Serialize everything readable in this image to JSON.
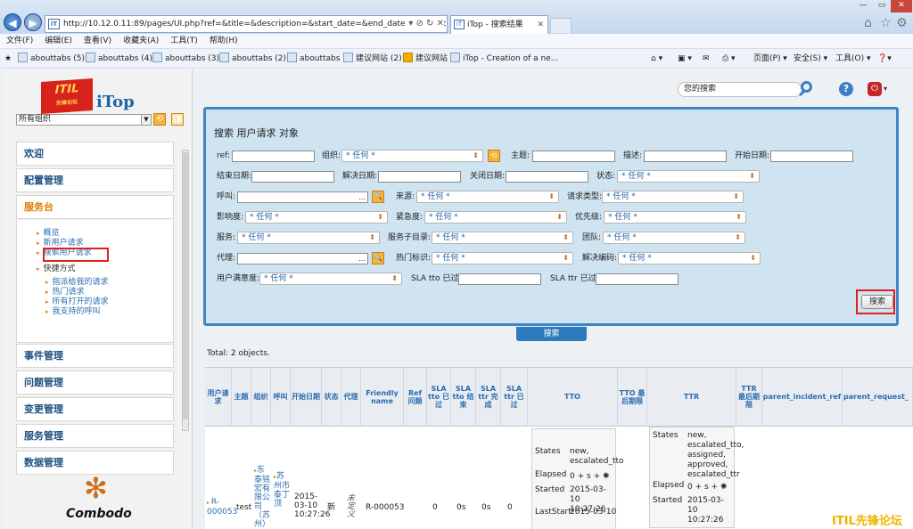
{
  "browser": {
    "address": "http://10.12.0.11:89/pages/UI.php?ref=&title=&description=&start_date=&end_date=&resolut",
    "tab_title": "iTop - 搜索结果",
    "menu": [
      "文件(F)",
      "编辑(E)",
      "查看(V)",
      "收藏夹(A)",
      "工具(T)",
      "帮助(H)"
    ],
    "favorites": [
      "abouttabs (5)",
      "abouttabs (4)",
      "abouttabs (3)",
      "abouttabs (2)",
      "abouttabs",
      "建议网站 (2)",
      "建议网站",
      "iTop - Creation of a ne..."
    ],
    "toolbar_right": [
      "页面(P) ▾",
      "安全(S) ▾",
      "工具(O) ▾"
    ]
  },
  "sidebar": {
    "org_select": "所有组织",
    "menus": [
      "欢迎",
      "配置管理",
      "服务台",
      "事件管理",
      "问题管理",
      "变更管理",
      "服务管理",
      "数据管理"
    ],
    "service_items": [
      "概览",
      "新用户请求",
      "搜索用户请求"
    ],
    "shortcuts_label": "快捷方式",
    "shortcut_items": [
      "指派给我的请求",
      "热门请求",
      "所有打开的请求",
      "我支持的呼叫"
    ],
    "footer_logo": "Combodo"
  },
  "header": {
    "search_placeholder": "您的搜索"
  },
  "search_form": {
    "title": "搜索 用户请求 对象",
    "any": "* 任何 *",
    "labels": {
      "ref": "ref:",
      "org": "组织:",
      "title": "主题:",
      "description": "描述:",
      "start_date": "开始日期:",
      "end_date": "结束日期:",
      "resolution_date": "解决日期:",
      "close_date": "关闭日期:",
      "status": "状态:",
      "caller": "呼叫:",
      "origin": "来源:",
      "request_type": "请求类型:",
      "impact": "影响度:",
      "urgency": "紧急度:",
      "priority": "优先级:",
      "service": "服务:",
      "subcategory": "服务子目录:",
      "team": "团队:",
      "agent": "代理:",
      "hot_flag": "热门标识:",
      "resolution_code": "解决编码:",
      "satisfaction": "用户满意度:",
      "sla_tto": "SLA tto 已过:",
      "sla_ttr": "SLA ttr 已过:"
    },
    "search_button": "搜索",
    "search_tab": "搜索"
  },
  "results": {
    "total": "Total: 2 objects.",
    "columns": [
      "用户请求",
      "主题",
      "组织",
      "呼叫",
      "开始日期",
      "状态",
      "代理",
      "Friendly name",
      "Ref 问题",
      "SLA tto 已过",
      "SLA tto 结束",
      "SLA ttr 完成",
      "SLA ttr 已过",
      "TTO",
      "TTO 最后期限",
      "TTR",
      "TTR 最后期限",
      "parent_incident_ref",
      "parent_request_"
    ],
    "row1": {
      "ref": "R-000053",
      "title": "test",
      "org": "东泰铭宏有限公司（苏州）",
      "caller": "苏州市泰丁顶",
      "start_date": "2015-03-10 10:27:26",
      "status": "新",
      "agent": "未定义",
      "friendly_name": "R-000053",
      "sla_tto_passed": "0",
      "sla_tto_over": "0s",
      "sla_ttr_done": "0s",
      "sla_ttr_passed": "0",
      "tto": {
        "states_label": "States",
        "states": "new, escalated_tto",
        "elapsed_label": "Elapsed",
        "elapsed": "0 + s +",
        "started_label": "Started",
        "started": "2015-03-10 10:27:26",
        "laststart_label": "LastStart",
        "laststart": "2015-03-10"
      },
      "ttr": {
        "states_label": "States",
        "states": "new, escalated_tto, assigned, approved, escalated_ttr",
        "elapsed_label": "Elapsed",
        "elapsed": "0 + s +",
        "started_label": "Started",
        "started": "2015-03-10 10:27:26"
      }
    }
  },
  "watermark": "ITIL先锋论坛"
}
